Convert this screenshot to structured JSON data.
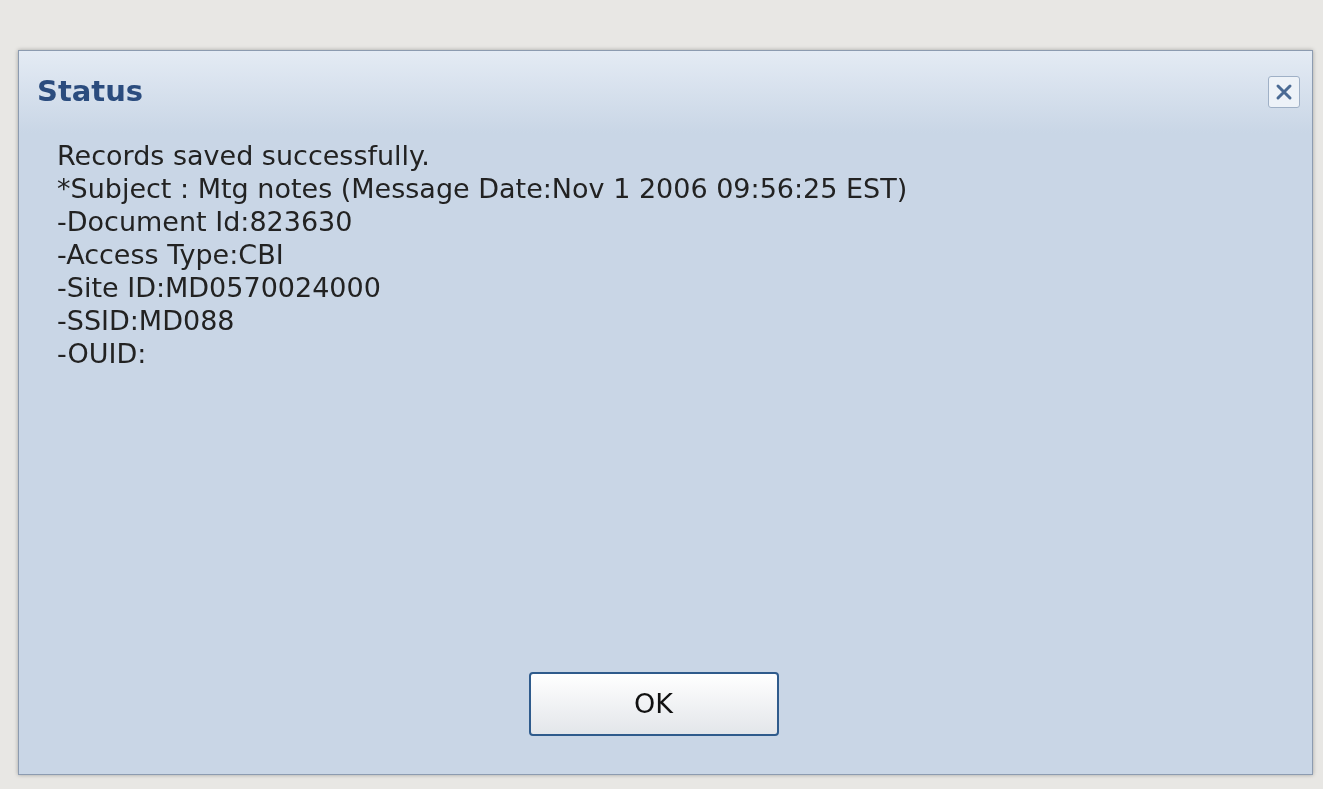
{
  "dialog": {
    "title": "Status",
    "message_lines": [
      "Records saved successfully.",
      "*Subject : Mtg notes (Message Date:Nov 1 2006 09:56:25 EST)",
      "-Document Id:823630",
      "-Access Type:CBI",
      "-Site ID:MD0570024000",
      "-SSID:MD088",
      "-OUID:"
    ],
    "buttons": [
      "OK"
    ]
  }
}
